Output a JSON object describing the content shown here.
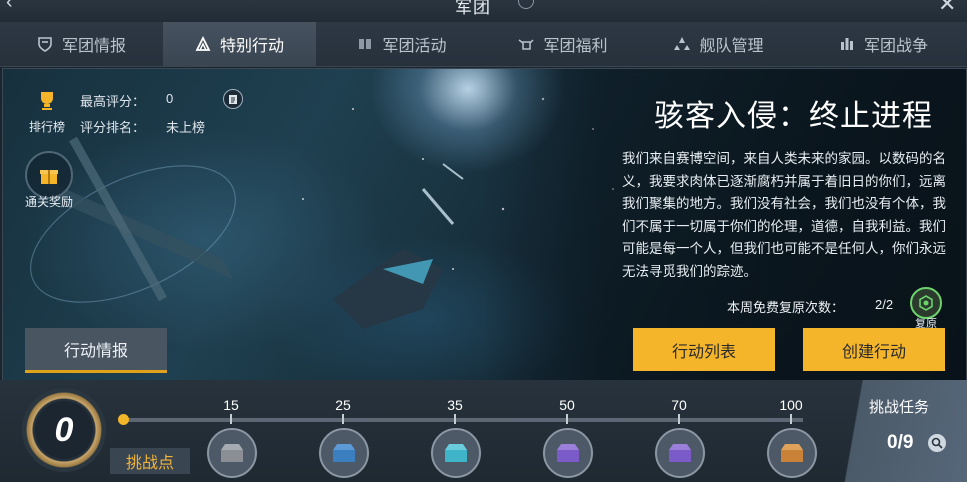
{
  "header": {
    "title": "军团"
  },
  "tabs": [
    {
      "label": "军团情报",
      "icon": "shield-icon"
    },
    {
      "label": "特别行动",
      "icon": "triangle-logo-icon"
    },
    {
      "label": "军团活动",
      "icon": "book-icon"
    },
    {
      "label": "军团福利",
      "icon": "gift-wing-icon"
    },
    {
      "label": "舰队管理",
      "icon": "fleet-icon"
    },
    {
      "label": "军团战争",
      "icon": "battle-icon"
    }
  ],
  "panel": {
    "rank_label": "排行榜",
    "best_score_label": "最高评分：",
    "best_score_value": "0",
    "score_rank_label": "评分排名：",
    "score_rank_value": "未上榜",
    "reward_label": "通关奖励",
    "event_title": "骇客入侵：终止进程",
    "description": "我们来自赛博空间，来自人类未来的家园。以数码的名义，我要求肉体已逐渐腐朽并属于着旧日的你们，远离我们聚集的地方。我们没有社会，我们也没有个体，我们不属于一切属于你们的伦理，道德，自我利益。我们可能是每一个人，但我们也可能不是任何人，你们永远无法寻觅我们的踪迹。",
    "revive_label": "本周免费复原次数：",
    "revive_value": "2/2",
    "revive_icon_label": "复原",
    "intel_button": "行动情报",
    "action_list_button": "行动列表",
    "create_action_button": "创建行动"
  },
  "progress": {
    "points_value": "0",
    "points_label": "挑战点",
    "milestones": [
      "15",
      "25",
      "35",
      "50",
      "70",
      "100"
    ],
    "chests": [
      "gray-chest-icon",
      "blue-chest-icon",
      "cyan-chest-icon",
      "purple-chest-icon",
      "purple-chest-icon",
      "orange-chest-icon"
    ],
    "chest_colors": [
      "#8b8f95",
      "#3c7fc0",
      "#3fb4c9",
      "#7a5bc8",
      "#7a5bc8",
      "#c98237"
    ],
    "task_label": "挑战任务",
    "task_value": "0/9"
  },
  "colors": {
    "accent": "#f5b52b",
    "tab_active": "#46525f"
  }
}
